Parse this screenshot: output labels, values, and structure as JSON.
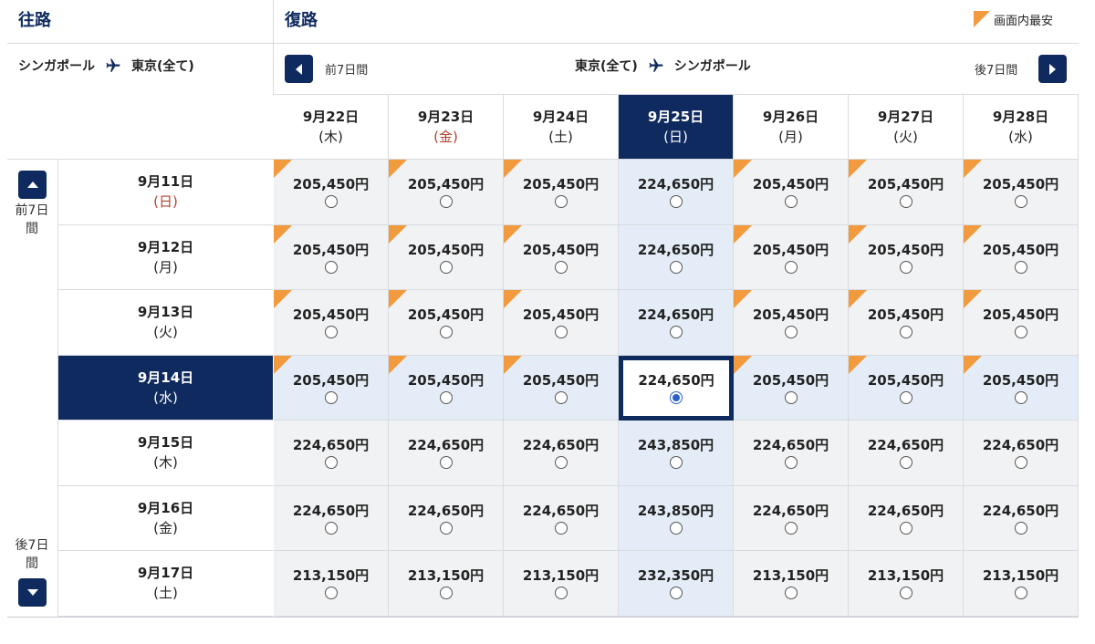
{
  "outbound": {
    "title": "往路",
    "origin": "シンガポール",
    "destination": "東京(全て)"
  },
  "return": {
    "title": "復路",
    "origin": "東京(全て)",
    "destination": "シンガポール",
    "prev_label": "前7日間",
    "next_label": "後7日間"
  },
  "legend": {
    "label": "画面内最安",
    "color": "#f19a3e"
  },
  "side": {
    "prev_label": "前7日間",
    "next_label": "後7日間"
  },
  "return_dates": [
    {
      "date": "9月22日",
      "dow": "(木)"
    },
    {
      "date": "9月23日",
      "dow": "(金)",
      "holiday": true
    },
    {
      "date": "9月24日",
      "dow": "(土)"
    },
    {
      "date": "9月25日",
      "dow": "(日)",
      "selected": true
    },
    {
      "date": "9月26日",
      "dow": "(月)"
    },
    {
      "date": "9月27日",
      "dow": "(火)"
    },
    {
      "date": "9月28日",
      "dow": "(水)"
    }
  ],
  "outbound_dates": [
    {
      "date": "9月11日",
      "dow": "(日)",
      "holiday": true
    },
    {
      "date": "9月12日",
      "dow": "(月)"
    },
    {
      "date": "9月13日",
      "dow": "(火)"
    },
    {
      "date": "9月14日",
      "dow": "(水)",
      "selected": true
    },
    {
      "date": "9月15日",
      "dow": "(木)"
    },
    {
      "date": "9月16日",
      "dow": "(金)"
    },
    {
      "date": "9月17日",
      "dow": "(土)"
    }
  ],
  "prices": [
    [
      "205,450円",
      "205,450円",
      "205,450円",
      "224,650円",
      "205,450円",
      "205,450円",
      "205,450円"
    ],
    [
      "205,450円",
      "205,450円",
      "205,450円",
      "224,650円",
      "205,450円",
      "205,450円",
      "205,450円"
    ],
    [
      "205,450円",
      "205,450円",
      "205,450円",
      "224,650円",
      "205,450円",
      "205,450円",
      "205,450円"
    ],
    [
      "205,450円",
      "205,450円",
      "205,450円",
      "224,650円",
      "205,450円",
      "205,450円",
      "205,450円"
    ],
    [
      "224,650円",
      "224,650円",
      "224,650円",
      "243,850円",
      "224,650円",
      "224,650円",
      "224,650円"
    ],
    [
      "224,650円",
      "224,650円",
      "224,650円",
      "243,850円",
      "224,650円",
      "224,650円",
      "224,650円"
    ],
    [
      "213,150円",
      "213,150円",
      "213,150円",
      "232,350円",
      "213,150円",
      "213,150円",
      "213,150円"
    ]
  ],
  "cheapest_flags": [
    [
      true,
      true,
      true,
      false,
      true,
      true,
      true
    ],
    [
      true,
      true,
      true,
      false,
      true,
      true,
      true
    ],
    [
      true,
      true,
      true,
      false,
      true,
      true,
      true
    ],
    [
      true,
      true,
      true,
      false,
      true,
      true,
      true
    ],
    [
      false,
      false,
      false,
      false,
      false,
      false,
      false
    ],
    [
      false,
      false,
      false,
      false,
      false,
      false,
      false
    ],
    [
      false,
      false,
      false,
      false,
      false,
      false,
      false
    ]
  ],
  "selection": {
    "outbound_date": "9月14日",
    "return_date": "9月25日"
  },
  "colors": {
    "navy": "#0f2a5f",
    "holiday_red": "#b3422e",
    "highlight": "#e4edf7",
    "cell_bg": "#f1f2f4"
  }
}
